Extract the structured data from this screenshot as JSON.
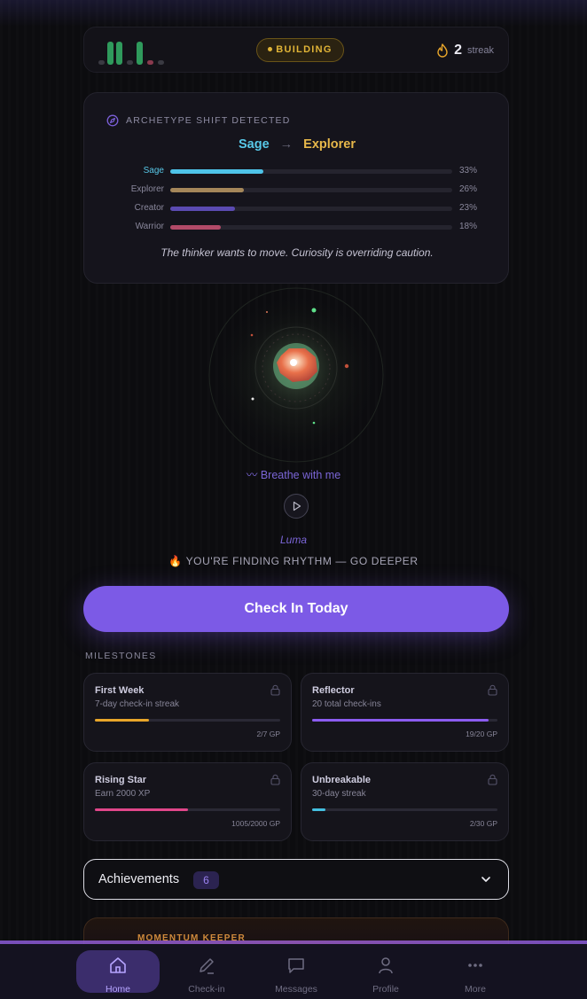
{
  "header": {
    "badge": "BUILDING",
    "streak_count": "2",
    "streak_label": "streak"
  },
  "archetype": {
    "heading": "ARCHETYPE SHIFT DETECTED",
    "from": "Sage",
    "arrow": "→",
    "to": "Explorer",
    "rows": [
      {
        "name": "Sage",
        "percent": "33%",
        "value": 33,
        "color": "#4ec3e8"
      },
      {
        "name": "Explorer",
        "percent": "26%",
        "value": 26,
        "color": "#a5875a"
      },
      {
        "name": "Creator",
        "percent": "23%",
        "value": 23,
        "color": "#5b4bb2"
      },
      {
        "name": "Warrior",
        "percent": "18%",
        "value": 18,
        "color": "#b24a68"
      }
    ],
    "quote": "The thinker wants to move. Curiosity is overriding caution."
  },
  "orb": {
    "breathe_label": "Breathe with me",
    "name": "Luma",
    "message": "🔥 YOU'RE FINDING RHYTHM — GO DEEPER"
  },
  "checkin_button": "Check In Today",
  "milestones": {
    "title": "MILESTONES",
    "items": [
      {
        "name": "First Week",
        "desc": "7-day check-in streak",
        "progress": "2/7 GP",
        "fraction": 0.29,
        "color": "#e8a62a"
      },
      {
        "name": "Reflector",
        "desc": "20 total check-ins",
        "progress": "19/20 GP",
        "fraction": 0.95,
        "color": "#8b5cf0"
      },
      {
        "name": "Rising Star",
        "desc": "Earn 2000 XP",
        "progress": "1005/2000 GP",
        "fraction": 0.5,
        "color": "#e0468a"
      },
      {
        "name": "Unbreakable",
        "desc": "30-day streak",
        "progress": "2/30 GP",
        "fraction": 0.07,
        "color": "#44bfe0"
      }
    ]
  },
  "achievements": {
    "label": "Achievements",
    "count": "6"
  },
  "momentum": {
    "title": "MOMENTUM KEEPER"
  },
  "nav": [
    {
      "label": "Home",
      "icon": "home-icon",
      "active": true
    },
    {
      "label": "Check-in",
      "icon": "pencil-icon",
      "active": false
    },
    {
      "label": "Messages",
      "icon": "message-icon",
      "active": false
    },
    {
      "label": "Profile",
      "icon": "user-icon",
      "active": false
    },
    {
      "label": "More",
      "icon": "more-icon",
      "active": false
    }
  ],
  "colors": {
    "accent": "#7c5ae6",
    "badge_gold": "#e0b437",
    "background": "#0c0c0f"
  }
}
